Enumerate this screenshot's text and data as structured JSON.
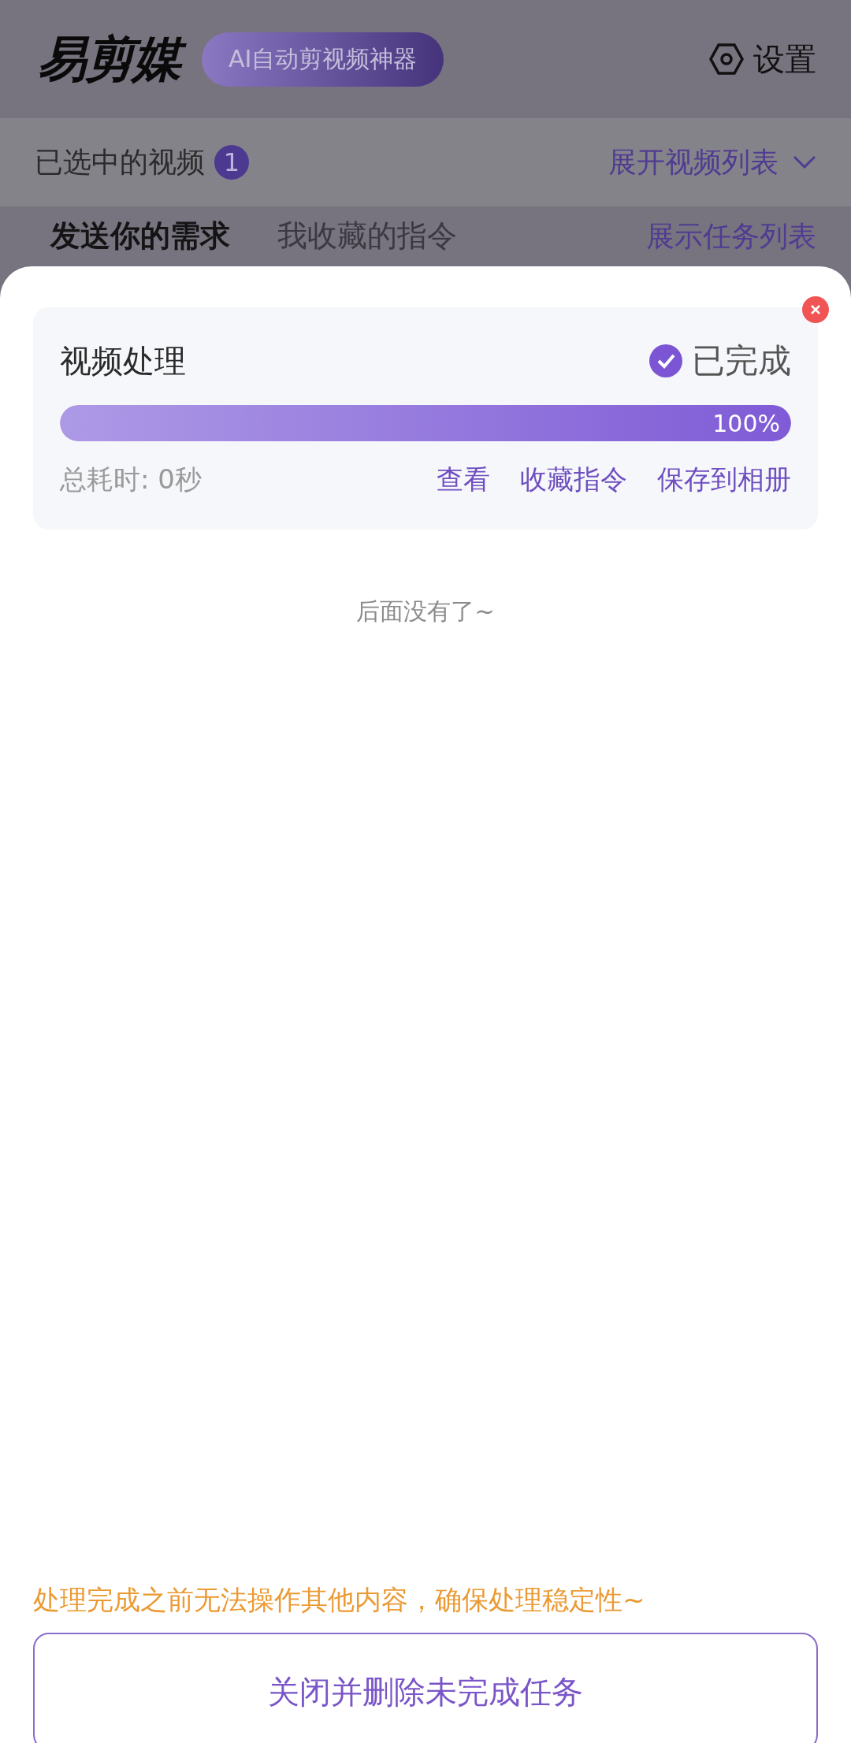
{
  "app": {
    "logo": "易剪媒",
    "slogan": "AI自动剪视频神器",
    "settings": "设置"
  },
  "selection": {
    "label": "已选中的视频",
    "count": "1",
    "expand": "展开视频列表"
  },
  "tabs": [
    {
      "label": "发送你的需求",
      "selected": true
    },
    {
      "label": "我收藏的指令",
      "selected": false
    }
  ],
  "task_list_link": "展示任务列表",
  "sheet": {
    "tasks": [
      {
        "title": "视频处理",
        "status": "已完成",
        "done": true,
        "level": 1,
        "percent": "100%",
        "elapsed": "总耗时: 0秒",
        "actions": [
          "查看",
          "收藏指令",
          "保存到相册"
        ]
      }
    ],
    "end_note": "后面没有了~",
    "warning": "处理完成之前无法操作其他内容，确保处理稳定性~",
    "close_button": "关闭并删除未完成任务"
  }
}
